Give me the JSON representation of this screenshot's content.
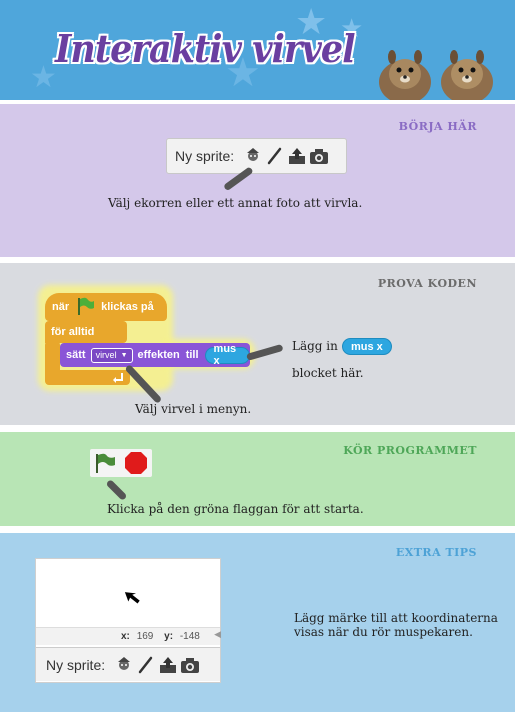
{
  "header": {
    "title": "Interaktiv virvel",
    "bg_color": "#4fa6db",
    "decor": "squirrels-image"
  },
  "section1": {
    "title": "BÖRJA HÄR",
    "color": "#d4c8ea",
    "sprite_label": "Ny sprite:",
    "icons": [
      "sprite-library-icon",
      "paint-brush-icon",
      "upload-icon",
      "camera-icon"
    ],
    "caption": "Välj ekorren eller ett annat foto att virvla."
  },
  "section2": {
    "title": "PROVA KODEN",
    "color": "#d9dbe0",
    "when_label": "när",
    "clicked_label": "klickas på",
    "forever_label": "för alltid",
    "set_label": "sätt",
    "effect_value": "virvel",
    "effect_label": "effekten",
    "to_label": "till",
    "reporter_label": "mus x",
    "put_in_label": "Lägg in",
    "block_here_label": "blocket här.",
    "choose_caption": "Välj virvel i menyn."
  },
  "section3": {
    "title": "KÖR PROGRAMMET",
    "color": "#b8e5b5",
    "caption": "Klicka på den gröna flaggan för att starta."
  },
  "section4": {
    "title": "EXTRA TIPS",
    "color": "#a6d1ec",
    "x_label": "x:",
    "x_value": "169",
    "y_label": "y:",
    "y_value": "-148",
    "sprite_label": "Ny sprite:",
    "tip_line1": "Lägg märke till att koordinaterna",
    "tip_line2": "visas när du rör muspekaren."
  }
}
